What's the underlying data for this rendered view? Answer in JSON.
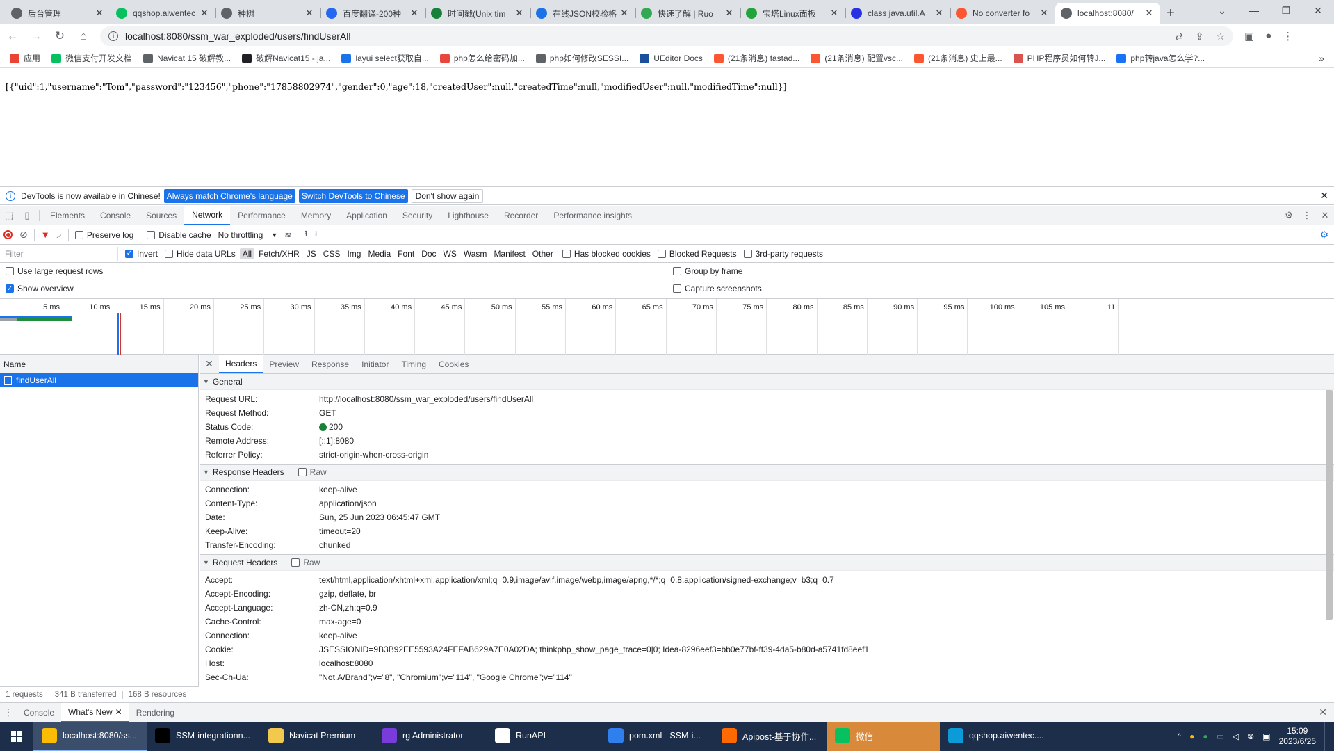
{
  "browser": {
    "tabs": [
      {
        "title": "后台管理",
        "favicon": "chrome-icon",
        "color": "#5f6368"
      },
      {
        "title": "qqshop.aiwentec",
        "favicon": "wechat-icon",
        "color": "#07c160"
      },
      {
        "title": "种树",
        "favicon": "globe-icon",
        "color": "#5f6368"
      },
      {
        "title": "百度翻译-200种",
        "favicon": "baidu-translate-icon",
        "color": "#2468f2"
      },
      {
        "title": "时间戳(Unix tim",
        "favicon": "timestamp-icon",
        "color": "#188038"
      },
      {
        "title": "在线JSON校验格",
        "favicon": "json-icon",
        "color": "#1a73e8"
      },
      {
        "title": "快速了解 | Ruo",
        "favicon": "leaf-icon",
        "color": "#34a853"
      },
      {
        "title": "宝塔Linux面板",
        "favicon": "shield-icon",
        "color": "#20a53a"
      },
      {
        "title": "class java.util.A",
        "favicon": "paw-icon",
        "color": "#2932e1"
      },
      {
        "title": "No converter fo",
        "favicon": "csdn-icon",
        "color": "#fc5531"
      },
      {
        "title": "localhost:8080/",
        "favicon": "globe-icon",
        "color": "#5f6368"
      }
    ],
    "new_tab_label": "+",
    "url": "localhost:8080/ssm_war_exploded/users/findUserAll",
    "bookmarks": [
      {
        "label": "应用",
        "color": "#ea4335"
      },
      {
        "label": "微信支付开发文档",
        "color": "#07c160"
      },
      {
        "label": "Navicat 15 破解教...",
        "color": "#5f6368"
      },
      {
        "label": "破解Navicat15 - ja...",
        "color": "#202124"
      },
      {
        "label": "layui select获取自...",
        "color": "#1a73e8"
      },
      {
        "label": "php怎么给密码加...",
        "color": "#e8453c"
      },
      {
        "label": "php如何修改SESSI...",
        "color": "#5f6368"
      },
      {
        "label": "UEditor Docs",
        "color": "#1a4f9c"
      },
      {
        "label": "(21条消息) fastad...",
        "color": "#fc5531"
      },
      {
        "label": "(21条消息) 配置vsc...",
        "color": "#fc5531"
      },
      {
        "label": "(21条消息) 史上最...",
        "color": "#fc5531"
      },
      {
        "label": "PHP程序员如何转J...",
        "color": "#d9534f"
      },
      {
        "label": "php转java怎么学?...",
        "color": "#1772f6"
      }
    ],
    "bookmarks_more": "»"
  },
  "page": {
    "json_text": "[{\"uid\":1,\"username\":\"Tom\",\"password\":\"123456\",\"phone\":\"17858802974\",\"gender\":0,\"age\":18,\"createdUser\":null,\"createdTime\":null,\"modifiedUser\":null,\"modifiedTime\":null}]"
  },
  "devtools": {
    "infobar": {
      "message": "DevTools is now available in Chinese!",
      "btn_match": "Always match Chrome's language",
      "btn_switch": "Switch DevTools to Chinese",
      "btn_dont_show": "Don't show again"
    },
    "tabs": [
      "Elements",
      "Console",
      "Sources",
      "Network",
      "Performance",
      "Memory",
      "Application",
      "Security",
      "Lighthouse",
      "Recorder",
      "Performance insights"
    ],
    "active_tab": "Network",
    "network_toolbar": {
      "preserve_log": "Preserve log",
      "disable_cache": "Disable cache",
      "throttling": "No throttling"
    },
    "filter": {
      "placeholder": "Filter",
      "invert": "Invert",
      "hide_data_urls": "Hide data URLs",
      "types": [
        "All",
        "Fetch/XHR",
        "JS",
        "CSS",
        "Img",
        "Media",
        "Font",
        "Doc",
        "WS",
        "Wasm",
        "Manifest",
        "Other"
      ],
      "has_blocked_cookies": "Has blocked cookies",
      "blocked_requests": "Blocked Requests",
      "third_party": "3rd-party requests"
    },
    "settings": {
      "large_rows": "Use large request rows",
      "show_overview": "Show overview",
      "group_by_frame": "Group by frame",
      "capture_screenshots": "Capture screenshots"
    },
    "overview_ticks": [
      "5 ms",
      "10 ms",
      "15 ms",
      "20 ms",
      "25 ms",
      "30 ms",
      "35 ms",
      "40 ms",
      "45 ms",
      "50 ms",
      "55 ms",
      "60 ms",
      "65 ms",
      "70 ms",
      "75 ms",
      "80 ms",
      "85 ms",
      "90 ms",
      "95 ms",
      "100 ms",
      "105 ms",
      "11"
    ],
    "name_header": "Name",
    "request_name": "findUserAll",
    "status": {
      "requests": "1 requests",
      "transferred": "341 B transferred",
      "resources": "168 B resources"
    },
    "detail_tabs": [
      "Headers",
      "Preview",
      "Response",
      "Initiator",
      "Timing",
      "Cookies"
    ],
    "general": {
      "title": "General",
      "rows": [
        {
          "k": "Request URL:",
          "v": "http://localhost:8080/ssm_war_exploded/users/findUserAll"
        },
        {
          "k": "Request Method:",
          "v": "GET"
        },
        {
          "k": "Status Code:",
          "v": "200"
        },
        {
          "k": "Remote Address:",
          "v": "[::1]:8080"
        },
        {
          "k": "Referrer Policy:",
          "v": "strict-origin-when-cross-origin"
        }
      ]
    },
    "response_headers": {
      "title": "Response Headers",
      "raw": "Raw",
      "rows": [
        {
          "k": "Connection:",
          "v": "keep-alive"
        },
        {
          "k": "Content-Type:",
          "v": "application/json"
        },
        {
          "k": "Date:",
          "v": "Sun, 25 Jun 2023 06:45:47 GMT"
        },
        {
          "k": "Keep-Alive:",
          "v": "timeout=20"
        },
        {
          "k": "Transfer-Encoding:",
          "v": "chunked"
        }
      ]
    },
    "request_headers": {
      "title": "Request Headers",
      "raw": "Raw",
      "rows": [
        {
          "k": "Accept:",
          "v": "text/html,application/xhtml+xml,application/xml;q=0.9,image/avif,image/webp,image/apng,*/*;q=0.8,application/signed-exchange;v=b3;q=0.7"
        },
        {
          "k": "Accept-Encoding:",
          "v": "gzip, deflate, br"
        },
        {
          "k": "Accept-Language:",
          "v": "zh-CN,zh;q=0.9"
        },
        {
          "k": "Cache-Control:",
          "v": "max-age=0"
        },
        {
          "k": "Connection:",
          "v": "keep-alive"
        },
        {
          "k": "Cookie:",
          "v": "JSESSIONID=9B3B92EE5593A24FEFAB629A7E0A02DA; thinkphp_show_page_trace=0|0; Idea-8296eef3=bb0e77bf-ff39-4da5-b80d-a5741fd8eef1"
        },
        {
          "k": "Host:",
          "v": "localhost:8080"
        },
        {
          "k": "Sec-Ch-Ua:",
          "v": "\"Not.A/Brand\";v=\"8\", \"Chromium\";v=\"114\", \"Google Chrome\";v=\"114\""
        }
      ]
    },
    "drawer_tabs": [
      "Console",
      "What's New",
      "Rendering"
    ]
  },
  "taskbar": {
    "items": [
      {
        "label": "localhost:8080/ss...",
        "icon": "chrome-icon",
        "color": "#fbbc04"
      },
      {
        "label": "SSM-integrationn...",
        "icon": "intellij-icon",
        "color": "#000000"
      },
      {
        "label": "Navicat Premium",
        "icon": "navicat-icon",
        "color": "#f2c94c"
      },
      {
        "label": "rg Administrator",
        "icon": "phpstorm-icon",
        "color": "#7a3bdb"
      },
      {
        "label": "RunAPI",
        "icon": "runapi-icon",
        "color": "#ffffff"
      },
      {
        "label": "pom.xml - SSM-i...",
        "icon": "vscode-icon",
        "color": "#2f80ed"
      },
      {
        "label": "Apipost-基于协作...",
        "icon": "apipost-icon",
        "color": "#ff6a00"
      },
      {
        "label": "微信",
        "icon": "wechat-icon",
        "color": "#07c160"
      },
      {
        "label": "qqshop.aiwentec....",
        "icon": "edge-icon",
        "color": "#0c9bd8"
      }
    ],
    "time": "15:09",
    "date": "2023/6/25"
  }
}
